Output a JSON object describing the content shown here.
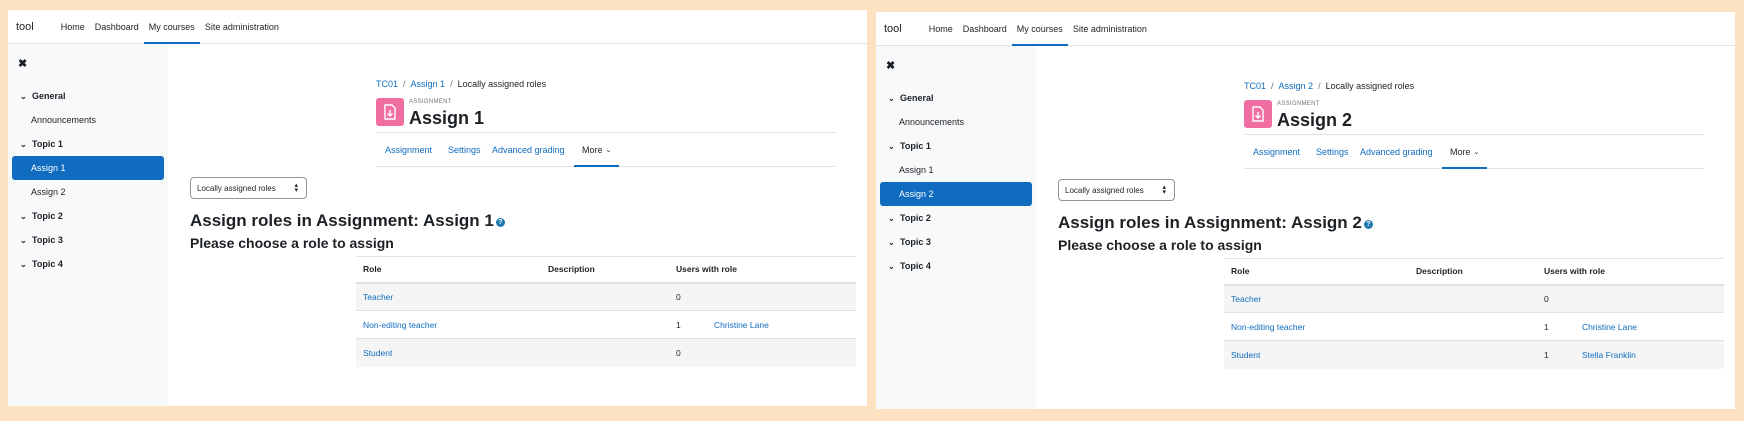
{
  "panels": [
    {
      "navbar": {
        "brand": "tool",
        "items": [
          {
            "label": "Home",
            "active": false
          },
          {
            "label": "Dashboard",
            "active": false
          },
          {
            "label": "My courses",
            "active": true
          },
          {
            "label": "Site administration",
            "active": false
          }
        ]
      },
      "drawer": {
        "close_icon": "close-icon",
        "items": [
          {
            "type": "section",
            "label": "General"
          },
          {
            "type": "link",
            "label": "Announcements"
          },
          {
            "type": "section",
            "label": "Topic 1"
          },
          {
            "type": "link",
            "label": "Assign 1",
            "active": true
          },
          {
            "type": "link",
            "label": "Assign 2"
          },
          {
            "type": "section",
            "label": "Topic 2"
          },
          {
            "type": "section",
            "label": "Topic 3"
          },
          {
            "type": "section",
            "label": "Topic 4"
          }
        ]
      },
      "breadcrumb": {
        "course": "TC01",
        "activity": "Assign 1",
        "current": "Locally assigned roles",
        "separator": "/"
      },
      "header": {
        "pretitle": "ASSIGNMENT",
        "title": "Assign 1",
        "icon": "assignment-icon",
        "icon_color": "#f06ea0"
      },
      "tabs": [
        {
          "label": "Assignment"
        },
        {
          "label": "Settings"
        },
        {
          "label": "Advanced grading"
        },
        {
          "label": "More"
        }
      ],
      "select": {
        "value": "Locally assigned roles"
      },
      "heading_assign": "Assign roles in Assignment: Assign 1",
      "heading_choose": "Please choose a role to assign",
      "table": {
        "headers": [
          "Role",
          "Description",
          "Users with role"
        ],
        "rows": [
          {
            "role": "Teacher",
            "description": "",
            "count": "0",
            "users": ""
          },
          {
            "role": "Non-editing teacher",
            "description": "",
            "count": "1",
            "users": "Christine Lane"
          },
          {
            "role": "Student",
            "description": "",
            "count": "0",
            "users": ""
          }
        ]
      }
    },
    {
      "navbar": {
        "brand": "tool",
        "items": [
          {
            "label": "Home",
            "active": false
          },
          {
            "label": "Dashboard",
            "active": false
          },
          {
            "label": "My courses",
            "active": true
          },
          {
            "label": "Site administration",
            "active": false
          }
        ]
      },
      "drawer": {
        "close_icon": "close-icon",
        "items": [
          {
            "type": "section",
            "label": "General"
          },
          {
            "type": "link",
            "label": "Announcements"
          },
          {
            "type": "section",
            "label": "Topic 1"
          },
          {
            "type": "link",
            "label": "Assign 1"
          },
          {
            "type": "link",
            "label": "Assign 2",
            "active": true
          },
          {
            "type": "section",
            "label": "Topic 2"
          },
          {
            "type": "section",
            "label": "Topic 3"
          },
          {
            "type": "section",
            "label": "Topic 4"
          }
        ]
      },
      "breadcrumb": {
        "course": "TC01",
        "activity": "Assign 2",
        "current": "Locally assigned roles",
        "separator": "/"
      },
      "header": {
        "pretitle": "ASSIGNMENT",
        "title": "Assign 2",
        "icon": "assignment-icon",
        "icon_color": "#f06ea0"
      },
      "tabs": [
        {
          "label": "Assignment"
        },
        {
          "label": "Settings"
        },
        {
          "label": "Advanced grading"
        },
        {
          "label": "More"
        }
      ],
      "select": {
        "value": "Locally assigned roles"
      },
      "heading_assign": "Assign roles in Assignment: Assign 2",
      "heading_choose": "Please choose a role to assign",
      "table": {
        "headers": [
          "Role",
          "Description",
          "Users with role"
        ],
        "rows": [
          {
            "role": "Teacher",
            "description": "",
            "count": "0",
            "users": ""
          },
          {
            "role": "Non-editing teacher",
            "description": "",
            "count": "1",
            "users": "Christine Lane"
          },
          {
            "role": "Student",
            "description": "",
            "count": "1",
            "users": "Stella Franklin"
          }
        ]
      }
    }
  ]
}
